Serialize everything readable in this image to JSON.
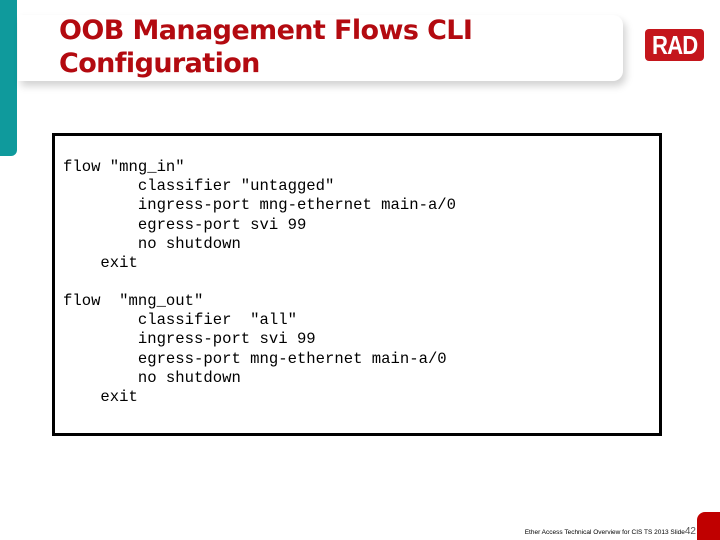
{
  "slide": {
    "title": "OOB Management Flows CLI\nConfiguration",
    "logo_text": "RAD",
    "colors": {
      "accent_teal": "#0f9a9c",
      "title_red": "#b30a10",
      "logo_red": "#c4161c",
      "corner_red": "#c00000"
    }
  },
  "code": {
    "flow_in": "flow \"mng_in\"\n        classifier \"untagged\"\n        ingress-port mng-ethernet main-a/0\n        egress-port svi 99\n        no shutdown\n    exit",
    "flow_out": "flow  \"mng_out\"\n        classifier  \"all\"\n        ingress-port svi 99\n        egress-port mng-ethernet main-a/0\n        no shutdown\n    exit"
  },
  "footer": {
    "caption": "Ether Access Technical Overview for CIS TS 2013  Slide",
    "slide_number": "42"
  }
}
